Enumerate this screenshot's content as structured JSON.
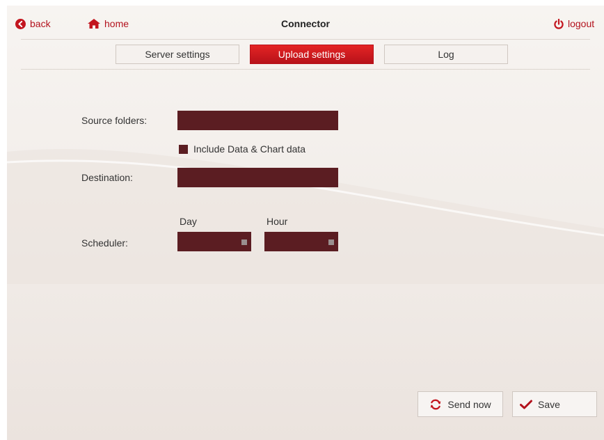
{
  "header": {
    "back_label": "back",
    "home_label": "home",
    "title": "Connector",
    "logout_label": "logout"
  },
  "tabs": [
    {
      "label": "Server settings",
      "active": false
    },
    {
      "label": "Upload settings",
      "active": true
    },
    {
      "label": "Log",
      "active": false
    }
  ],
  "form": {
    "source_folders_label": "Source folders:",
    "source_folders_value": "",
    "include_label": "Include Data & Chart data",
    "include_checked": false,
    "destination_label": "Destination:",
    "destination_value": "",
    "scheduler_label": "Scheduler:",
    "day_label": "Day",
    "day_value": "",
    "hour_label": "Hour",
    "hour_value": ""
  },
  "actions": {
    "send_now_label": "Send now",
    "save_label": "Save"
  },
  "colors": {
    "accent": "#c3161f",
    "field": "#5b1d22"
  },
  "icons": {
    "back": "back-arrow-circle-icon",
    "home": "home-icon",
    "logout": "power-icon",
    "send_now": "refresh-icon",
    "save": "checkmark-icon"
  }
}
